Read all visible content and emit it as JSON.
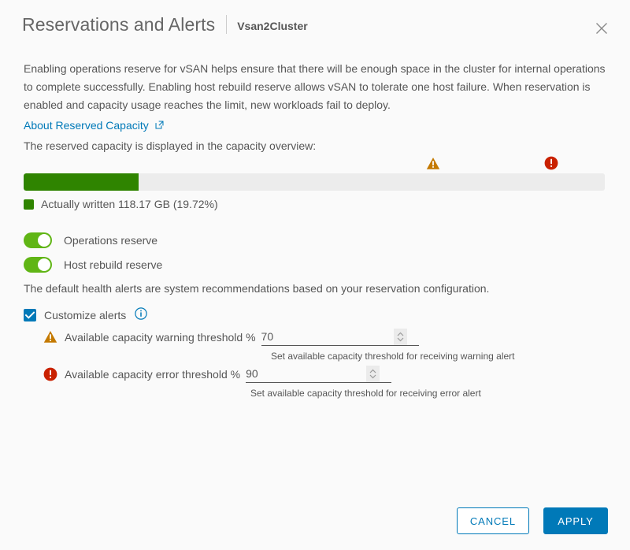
{
  "header": {
    "title": "Reservations and Alerts",
    "subtitle": "Vsan2Cluster",
    "close_icon": "close-icon"
  },
  "description": {
    "paragraph": "Enabling operations reserve for vSAN helps ensure that there will be enough space in the cluster for internal operations to complete successfully. Enabling host rebuild reserve allows vSAN to tolerate one host failure. When reservation is enabled and capacity usage reaches the limit, new workloads fail to deploy.",
    "link_text": "About Reserved Capacity",
    "link_icon": "external-link-icon",
    "note": "The reserved capacity is displayed in the capacity overview:"
  },
  "capacity": {
    "fill_percent": 19.72,
    "fill_color": "#2f8400",
    "track_color": "#ececec",
    "legend_label": "Actually written 118.17 GB (19.72%)",
    "warning_marker_icon": "warning-triangle-icon",
    "warning_marker_percent": 70,
    "error_marker_icon": "error-octagon-icon",
    "error_marker_percent": 90
  },
  "toggles": [
    {
      "label": "Operations reserve",
      "enabled": true,
      "name": "operations-reserve"
    },
    {
      "label": "Host rebuild reserve",
      "enabled": true,
      "name": "host-rebuild-reserve"
    }
  ],
  "alerts": {
    "intro": "The default health alerts are system recommendations based on your reservation configuration.",
    "customize_label": "Customize alerts",
    "customize_checked": true,
    "info_icon": "info-icon",
    "warning": {
      "icon": "warning-triangle-icon",
      "label": "Available capacity warning threshold %",
      "value": "70",
      "placeholder": "",
      "helper": "Set available capacity threshold for receiving warning alert"
    },
    "error": {
      "icon": "error-octagon-icon",
      "label": "Available capacity error threshold %",
      "value": "90",
      "placeholder": "",
      "helper": "Set available capacity threshold for receiving error alert"
    }
  },
  "footer": {
    "cancel_label": "CANCEL",
    "apply_label": "APPLY"
  },
  "colors": {
    "accent": "#0079b8",
    "green": "#2f8400",
    "toggle_green": "#60b515",
    "warning": "#c47900",
    "error": "#c92100"
  }
}
